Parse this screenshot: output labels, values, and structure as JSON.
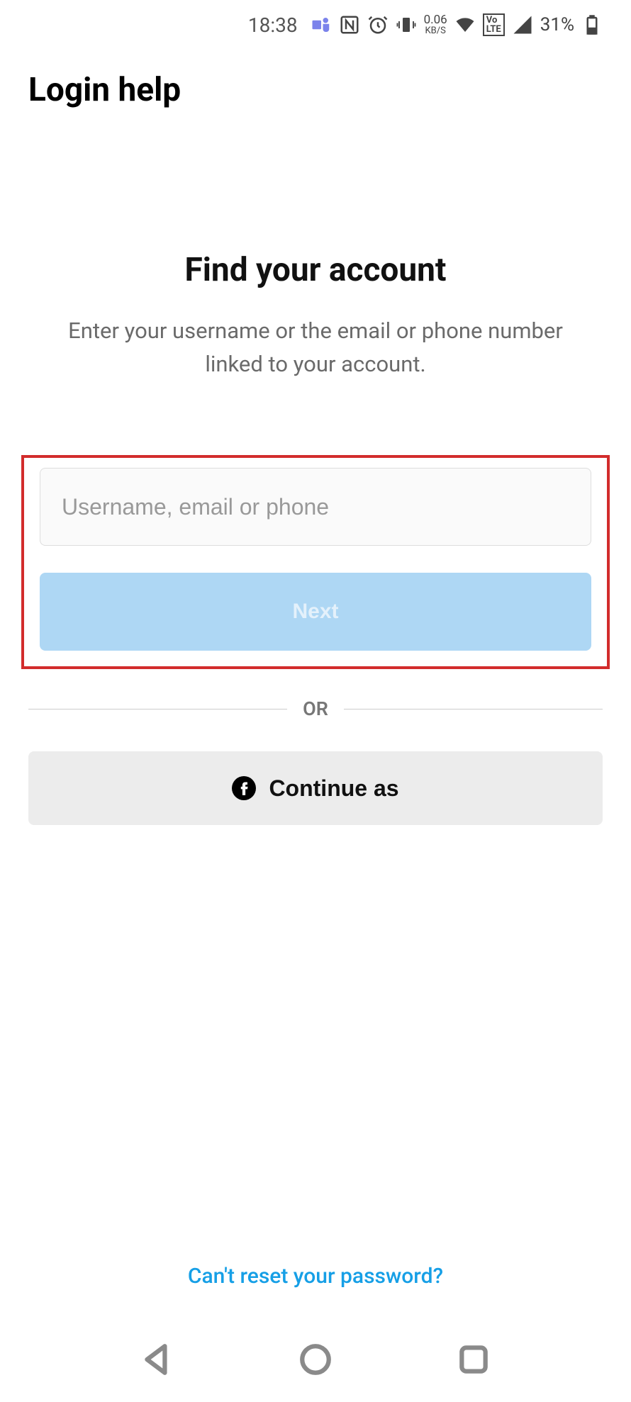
{
  "statusBar": {
    "time": "18:38",
    "kbs_top": "0.06",
    "kbs_bot": "KB/S",
    "volte": "VoLTE",
    "battery_pct": "31%"
  },
  "page": {
    "title": "Login help",
    "heading": "Find your account",
    "subheading": "Enter your username or the email or phone number linked to your account."
  },
  "form": {
    "input_placeholder": "Username, email or phone",
    "next_label": "Next",
    "or_label": "OR",
    "facebook_label": "Continue as"
  },
  "footer": {
    "cant_reset": "Can't reset your password?"
  }
}
